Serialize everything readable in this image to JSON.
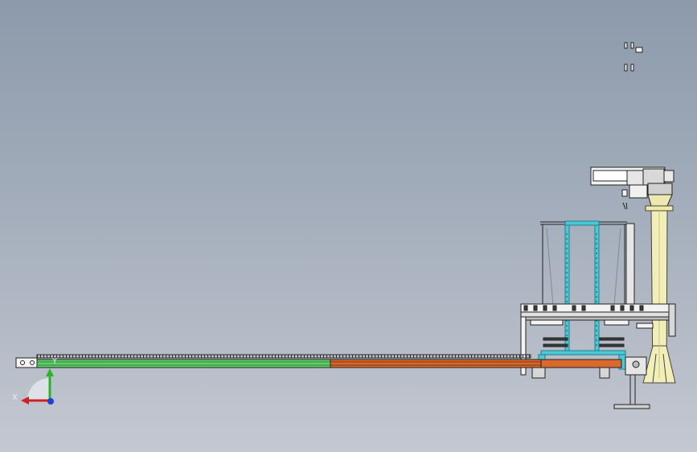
{
  "viewport": {
    "kind": "CAD assembly view",
    "background_top": "#8c9aab",
    "background_bottom": "#c4c8d1"
  },
  "triad": {
    "x_label": "X",
    "y_label": "Y",
    "x_color": "#d42020",
    "y_color": "#28b428",
    "z_color": "#1f3fd8"
  },
  "model": {
    "colors": {
      "frame": "#2b2b2b",
      "frame_light": "#f2f2f2",
      "rail_green": "#5fd06a",
      "rail_orange": "#d9692c",
      "cyan_frame": "#4cc9d6",
      "column_yellow": "#f2eeb8",
      "tray_grey": "#cfcfcf"
    }
  }
}
